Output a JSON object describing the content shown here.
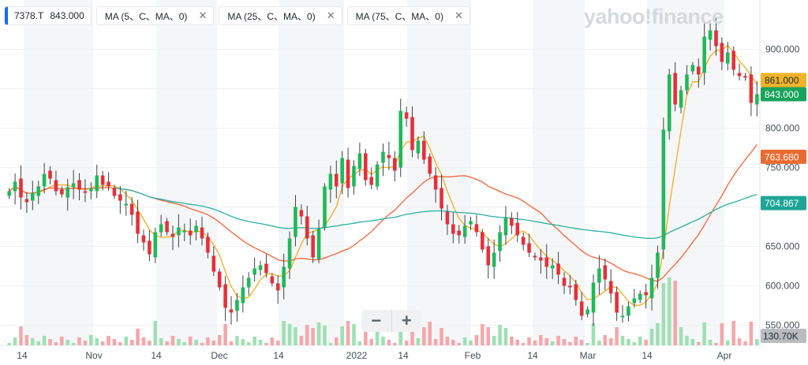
{
  "legend": {
    "ticker": "7378.T",
    "price": "843.000",
    "ma5": "MA (5、C、MA、0)",
    "ma25": "MA (25、C、MA、0)",
    "ma75": "MA (75、C、MA、0)",
    "close_symbol": "✕"
  },
  "watermark": "yahoo!finance",
  "zoom": {
    "minus": "−",
    "plus": "+"
  },
  "chart_data": {
    "type": "candlestick",
    "ylim": [
      540,
      960
    ],
    "y_ticks": [
      "900.000",
      "850.000",
      "800.000",
      "750.000",
      "700.000",
      "650.000",
      "600.000",
      "550.000"
    ],
    "x_ticks": [
      "14",
      "Nov",
      "14",
      "Dec",
      "14",
      "2022",
      "14",
      "Feb",
      "14",
      "Mar",
      "14",
      "Apr"
    ],
    "closes": [
      720,
      732,
      712,
      706,
      718,
      726,
      742,
      736,
      720,
      716,
      725,
      730,
      722,
      718,
      724,
      740,
      728,
      726,
      714,
      708,
      704,
      690,
      666,
      655,
      640,
      668,
      678,
      668,
      662,
      674,
      670,
      664,
      676,
      660,
      642,
      618,
      598,
      572,
      566,
      582,
      598,
      610,
      622,
      626,
      616,
      603,
      594,
      624,
      660,
      700,
      688,
      660,
      636,
      672,
      726,
      742,
      726,
      762,
      724,
      752,
      768,
      734,
      728,
      754,
      770,
      762,
      746,
      822,
      812,
      772,
      784,
      760,
      742,
      722,
      698,
      678,
      666,
      664,
      676,
      682,
      668,
      646,
      626,
      642,
      668,
      686,
      676,
      664,
      652,
      642,
      636,
      632,
      624,
      626,
      614,
      600,
      598,
      582,
      562,
      570,
      604,
      622,
      608,
      590,
      566,
      562,
      574,
      584,
      590,
      588,
      610,
      642,
      798,
      868,
      830,
      848,
      868,
      880,
      868,
      916,
      924,
      904,
      884,
      896,
      874,
      866,
      864,
      832,
      843
    ],
    "series": [
      {
        "name": "MA (5、C、MA、0)",
        "color": "#f0ad25"
      },
      {
        "name": "MA (25、C、MA、0)",
        "color": "#f0643b"
      },
      {
        "name": "MA (75、C、MA、0)",
        "color": "#2bafa4"
      }
    ],
    "price_labels": [
      {
        "value": 861,
        "text": "861.000",
        "color": "#f0b429"
      },
      {
        "value": 843,
        "text": "843.000",
        "color": "#1aa35c"
      },
      {
        "value": 763.68,
        "text": "763.680",
        "color": "#ea6b31"
      },
      {
        "value": 704.867,
        "text": "704.867",
        "color": "#1ea596"
      }
    ],
    "volume_label": "130.70K",
    "up_color": "#21b85a",
    "down_color": "#e5303a",
    "grid": true
  }
}
